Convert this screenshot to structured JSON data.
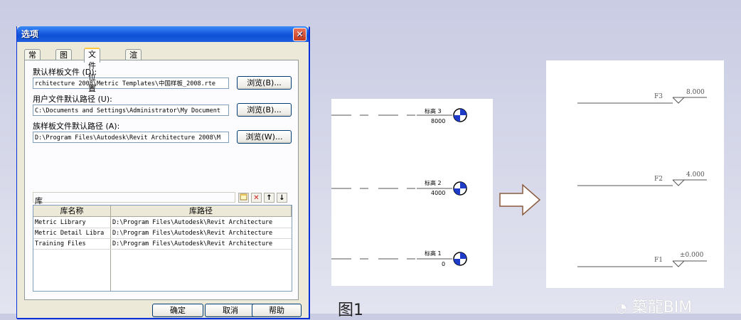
{
  "dialog": {
    "title": "选项",
    "close_glyph": "✕",
    "tabs": [
      "常规",
      "图形",
      "文件位置",
      "渲染"
    ],
    "active_tab": "文件位置",
    "default_template_label": "默认样板文件 (D):",
    "default_template_value": "rchitecture 2008\\Metric Templates\\中国样板_2008.rte",
    "browse_d": "浏览(B)...",
    "user_path_label": "用户文件默认路径 (U):",
    "user_path_value": "C:\\Documents and Settings\\Administrator\\My Document",
    "browse_b": "浏览(B)...",
    "family_template_label": "族样板文件默认路径 (A):",
    "family_template_value": "D:\\Program Files\\Autodesk\\Revit Architecture 2008\\M",
    "browse_w": "浏览(W)...",
    "library_label": "库",
    "library_headers": [
      "库名称",
      "库路径"
    ],
    "library_rows": [
      {
        "name": "Metric Library",
        "path": "D:\\Program Files\\Autodesk\\Revit Architecture"
      },
      {
        "name": "Metric Detail Libra",
        "path": "D:\\Program Files\\Autodesk\\Revit Architecture"
      },
      {
        "name": "Training Files",
        "path": "D:\\Program Files\\Autodesk\\Revit Architecture"
      }
    ],
    "ok": "确定",
    "cancel": "取消",
    "help": "帮助"
  },
  "figure1": {
    "levels": [
      {
        "name": "标高 3",
        "value": "8000"
      },
      {
        "name": "标高 2",
        "value": "4000"
      },
      {
        "name": "标高 1",
        "value": "0"
      }
    ],
    "caption": "图1"
  },
  "figure2": {
    "levels": [
      {
        "name": "F3",
        "value": "8.000"
      },
      {
        "name": "F2",
        "value": "4.000"
      },
      {
        "name": "F1",
        "value": "±0.000"
      }
    ]
  },
  "watermark": "築龍BIM"
}
